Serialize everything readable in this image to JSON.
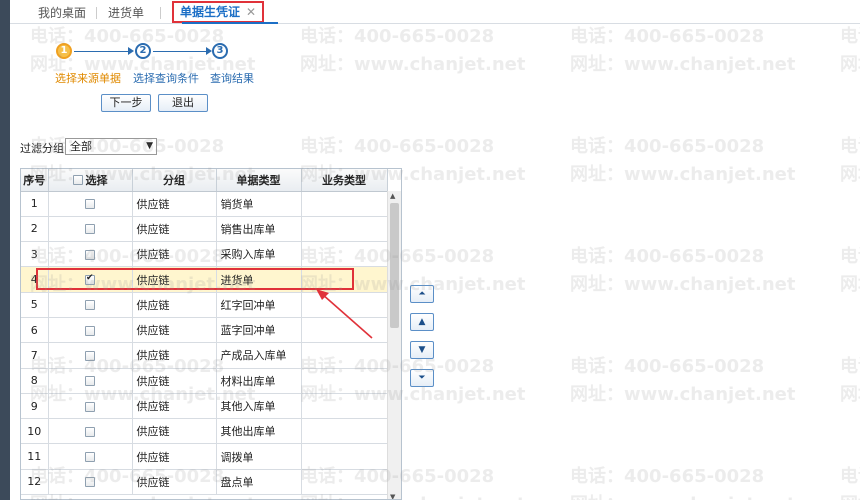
{
  "tabs": [
    {
      "label": "我的桌面"
    },
    {
      "label": "进货单"
    },
    {
      "label": "单据生凭证",
      "close": "✕"
    }
  ],
  "steps": [
    {
      "num": "1",
      "label": "选择来源单据"
    },
    {
      "num": "2",
      "label": "选择查询条件"
    },
    {
      "num": "3",
      "label": "查询结果"
    }
  ],
  "buttons": {
    "next": "下一步",
    "exit": "退出"
  },
  "filter": {
    "label": "过滤分组:",
    "value": "全部",
    "arrow": "▼"
  },
  "table": {
    "headers": {
      "idx": "序号",
      "select": "选择",
      "group": "分组",
      "doc_type": "单据类型",
      "biz_type": "业务类型"
    },
    "rows": [
      {
        "idx": "1",
        "group": "供应链",
        "doc_type": "销货单",
        "biz_type": "",
        "checked": false
      },
      {
        "idx": "2",
        "group": "供应链",
        "doc_type": "销售出库单",
        "biz_type": "",
        "checked": false
      },
      {
        "idx": "3",
        "group": "供应链",
        "doc_type": "采购入库单",
        "biz_type": "",
        "checked": false
      },
      {
        "idx": "4",
        "group": "供应链",
        "doc_type": "进货单",
        "biz_type": "",
        "checked": true
      },
      {
        "idx": "5",
        "group": "供应链",
        "doc_type": "红字回冲单",
        "biz_type": "",
        "checked": false
      },
      {
        "idx": "6",
        "group": "供应链",
        "doc_type": "蓝字回冲单",
        "biz_type": "",
        "checked": false
      },
      {
        "idx": "7",
        "group": "供应链",
        "doc_type": "产成品入库单",
        "biz_type": "",
        "checked": false
      },
      {
        "idx": "8",
        "group": "供应链",
        "doc_type": "材料出库单",
        "biz_type": "",
        "checked": false
      },
      {
        "idx": "9",
        "group": "供应链",
        "doc_type": "其他入库单",
        "biz_type": "",
        "checked": false
      },
      {
        "idx": "10",
        "group": "供应链",
        "doc_type": "其他出库单",
        "biz_type": "",
        "checked": false
      },
      {
        "idx": "11",
        "group": "供应链",
        "doc_type": "调拨单",
        "biz_type": "",
        "checked": false
      },
      {
        "idx": "12",
        "group": "供应链",
        "doc_type": "盘点单",
        "biz_type": "",
        "checked": false
      }
    ]
  },
  "move_buttons": [
    {
      "name": "move-top-button",
      "glyph": "⏶"
    },
    {
      "name": "move-up-button",
      "glyph": "▲"
    },
    {
      "name": "move-down-button",
      "glyph": "▼"
    },
    {
      "name": "move-bottom-button",
      "glyph": "⏷"
    }
  ],
  "watermark": {
    "phone": "电话：400-665-0028",
    "site": "网址：www.chanjet.net"
  },
  "colors": {
    "accent": "#1c6fc6",
    "highlight": "#e0323a",
    "selected_row": "#fff6cf",
    "step_active": "#f6c04a"
  }
}
